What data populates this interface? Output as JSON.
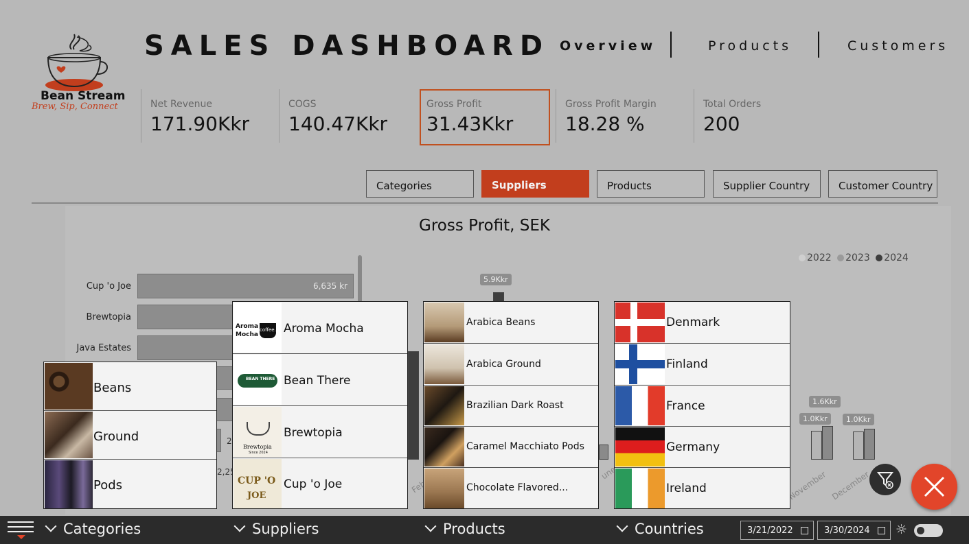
{
  "logo": {
    "name": "Bean Stream",
    "tagline": "Brew, Sip, Connect"
  },
  "header": {
    "title": "SALES DASHBOARD",
    "nav": [
      "Overview",
      "Products",
      "Customers"
    ]
  },
  "kpis": [
    {
      "label": "Net Revenue",
      "value": "171.90Kkr"
    },
    {
      "label": "COGS",
      "value": "140.47Kkr"
    },
    {
      "label": "Gross Profit",
      "value": "31.43Kkr",
      "selected": true
    },
    {
      "label": "Gross Profit Margin",
      "value": "18.28 %"
    },
    {
      "label": "Total Orders",
      "value": "200"
    }
  ],
  "tabs": [
    "Categories",
    "Suppliers",
    "Products",
    "Supplier Country",
    "Customer Country"
  ],
  "active_tab": "Suppliers",
  "chart_data": [
    {
      "type": "bar",
      "title": "Gross Profit, SEK",
      "orientation": "horizontal",
      "categories": [
        "Cup 'o Joe",
        "Brewtopia",
        "Java Estates"
      ],
      "values": [
        6635,
        null,
        null
      ],
      "visible_value_labels": [
        "6,635 kr",
        "",
        ""
      ],
      "partially_visible_labels": [
        "2",
        "2,25"
      ]
    },
    {
      "type": "bar",
      "legend": [
        "2022",
        "2023",
        "2024"
      ],
      "legend_colors": [
        "#cfcfcf",
        "#9a9a9a",
        "#3e3e3e"
      ],
      "legend_placement": "top-right",
      "data_labels": [
        "5.9Kkr",
        "1.6Kkr",
        "1.0Kkr",
        "1.0Kkr"
      ],
      "x_tick_labels_visible": [
        "Feb",
        "une",
        "November",
        "December"
      ]
    }
  ],
  "slicers": {
    "categories": [
      "Beans",
      "Ground",
      "Pods"
    ],
    "suppliers": [
      {
        "name": "Aroma Mocha",
        "logo_text": [
          "Aroma",
          "Mocha",
          "coffee."
        ]
      },
      {
        "name": "Bean There",
        "logo_text": [
          "BEAN THERE"
        ]
      },
      {
        "name": "Brewtopia",
        "logo_text": [
          "Brewtopia",
          "Since 2024"
        ]
      },
      {
        "name": "Cup 'o Joe",
        "logo_text": [
          "CUP 'O",
          "JOE"
        ]
      }
    ],
    "products": [
      "Arabica Beans",
      "Arabica Ground",
      "Brazilian Dark Roast",
      "Caramel Macchiato Pods",
      "Chocolate Flavored..."
    ],
    "countries": [
      "Denmark",
      "Finland",
      "France",
      "Germany",
      "Ireland"
    ]
  },
  "bottom_bar": {
    "filters": [
      "Categories",
      "Suppliers",
      "Products",
      "Countries"
    ],
    "date_from": "3/21/2022",
    "date_to": "3/30/2024"
  },
  "colors": {
    "accent": "#c23e1d",
    "close_button": "#e2452a",
    "bottom_bar": "#2b2b2b"
  }
}
